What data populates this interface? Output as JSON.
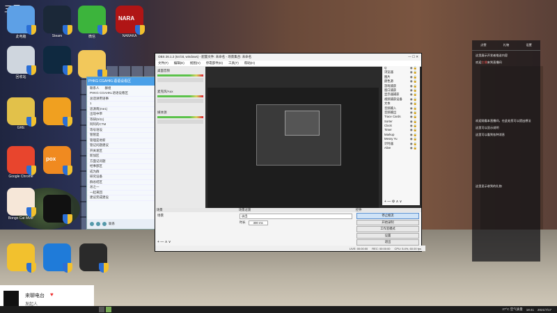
{
  "desktop": {
    "corner_text": "三里",
    "icons": [
      {
        "label": "此电脑",
        "color": "#5da0e6"
      },
      {
        "label": "Steam",
        "color": "#1b2838"
      },
      {
        "label": "微信",
        "color": "#3cb43c"
      },
      {
        "label": "NARAKA",
        "color": "#b01515",
        "img_text": "NARA"
      },
      {
        "label": "回收站",
        "color": "#cfd6de"
      },
      {
        "label": "",
        "color": "#0f2940"
      },
      {
        "label": "文件夹",
        "color": "#f2c85b"
      },
      {
        "label": "GRE",
        "color": "#e2c14a"
      },
      {
        "label": "",
        "color": "#f0a020"
      },
      {
        "label": "Google Chrome",
        "color": "#e8452d"
      },
      {
        "label": "",
        "color": "#f08a20",
        "img_text": "pox"
      },
      {
        "label": "Bongo Cat Mver",
        "color": "#f6e7d8"
      },
      {
        "label": "",
        "color": "#111111"
      },
      {
        "label": "",
        "color": "#f2c12e"
      },
      {
        "label": "",
        "color": "#1f7bd9"
      },
      {
        "label": "",
        "color": "#2a2a2a"
      }
    ]
  },
  "qq": {
    "title": "PHKG CGAHKL语语设看区",
    "tabs": [
      "联系人",
      "群组"
    ],
    "rows": [
      "PHKG CGAHKL语语设看区",
      "总话讲用语事",
      "1",
      "思源南(me1)",
      "出现中帝",
      "等研(5/11)",
      "阿阿的CTM",
      "等号语设",
      "管管是",
      "管理是地新",
      "管记问题建议",
      "开关发区",
      "新加区",
      "方面记问题",
      "经事部区",
      "成为群",
      "研究设备",
      "群总结区",
      "总之一",
      "一起来回",
      "建议完成建设"
    ],
    "footer": "联系"
  },
  "obs": {
    "title": "OBS 26.1.2 (64 bit, windows) - 配置文件: 未命名 - 场景集合: 未命名",
    "menu": [
      "文件(F)",
      "编辑(E)",
      "视图(V)",
      "停靠部件(D)",
      "工具(T)",
      "帮助(H)"
    ],
    "mixer": [
      {
        "label": "桌面音频"
      },
      {
        "label": "麦克风/Aux"
      },
      {
        "label": "媒体源"
      }
    ],
    "sources": [
      "Q",
      "浏览器",
      "图片",
      "颜色源",
      "游戏捕获",
      "窗口捕获",
      "显示器捕获",
      "视频捕获设备",
      "文本",
      "音频输入",
      "音频输出",
      "Trace Cards",
      "Sorter",
      "Clock",
      "Timer",
      "Markup",
      "Messy Yu",
      "计时器",
      "Alive"
    ],
    "panels": {
      "scenes": "场景",
      "scene_item": "场景",
      "transitions": "场景过渡",
      "transition_type": "淡出",
      "duration_label": "时长",
      "duration_value": "300 ms",
      "controls": "控件"
    },
    "controls": [
      {
        "label": "停止推流",
        "active": true
      },
      {
        "label": "开始录制",
        "active": false
      },
      {
        "label": "工作室模式",
        "active": false
      },
      {
        "label": "设置",
        "active": false
      },
      {
        "label": "退出",
        "active": false
      }
    ],
    "status": {
      "live": "LIVE: 00:00:00",
      "rec": "REC: 00:00:00",
      "cpu": "CPU: 5.4%, 60.00 fps"
    }
  },
  "chat": {
    "top": [
      "点赞",
      "礼物",
      "设置"
    ],
    "messages": [
      {
        "text": "这里展示开发者推送内容"
      },
      {
        "text": "欢迎",
        "hi": "主播",
        "tail": "来到直播间"
      },
      {
        "text": "欢迎观看本直播间，在此处您可以提出想法"
      },
      {
        "text": "这里可以显示说明"
      },
      {
        "text": "这里可以看到各种消息"
      },
      {
        "text": "这里显示收到的礼物"
      }
    ]
  },
  "notice": {
    "title": "来聊电台",
    "subtitle": "发起人"
  },
  "taskbar": {
    "weather": "27°C 空气质量",
    "time": "18:41",
    "date": "2021/7/17"
  }
}
